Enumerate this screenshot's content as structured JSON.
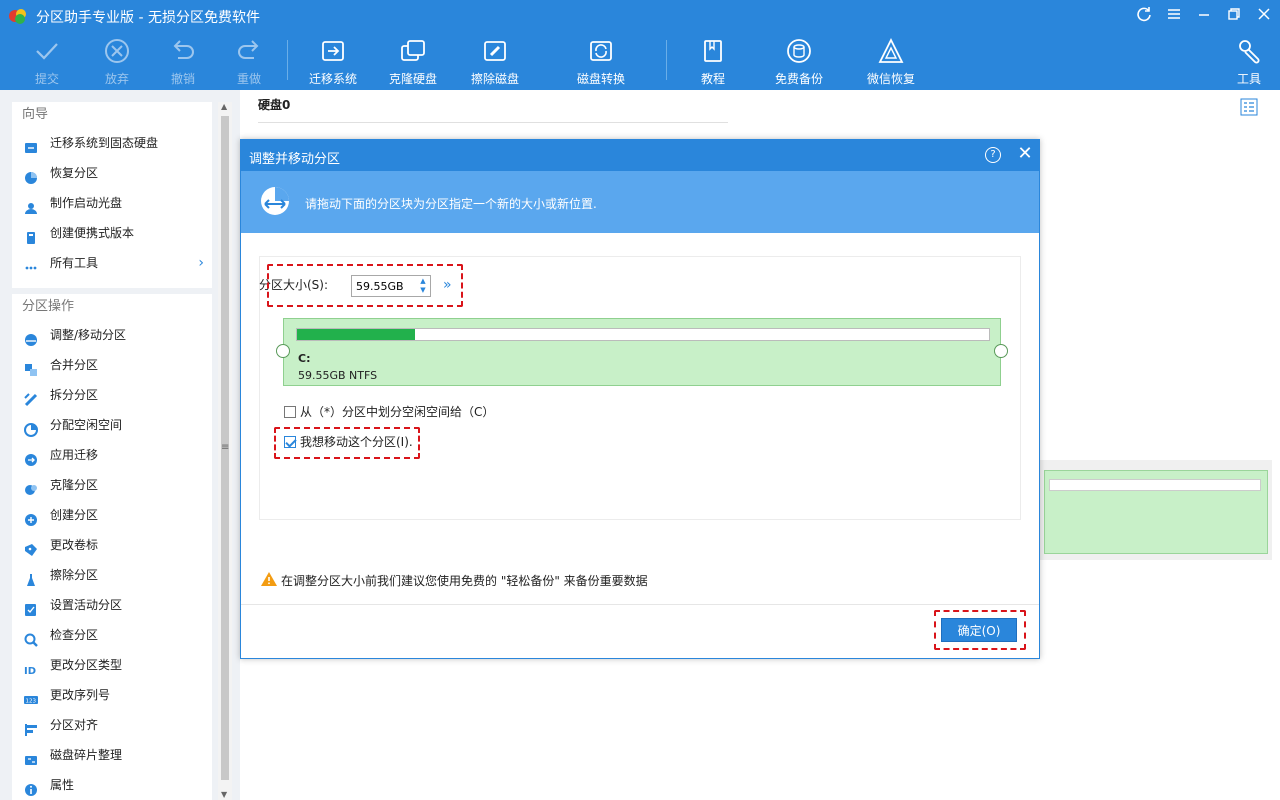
{
  "app": {
    "title": "分区助手专业版 - 无损分区免费软件"
  },
  "toolbar": {
    "commit": "提交",
    "discard": "放弃",
    "undo": "撤销",
    "redo": "重做",
    "migrate_os": "迁移系统",
    "clone_disk": "克隆硬盘",
    "wipe_disk": "擦除磁盘",
    "disk_convert": "磁盘转换",
    "tutorial": "教程",
    "free_backup": "免费备份",
    "wechat_recovery": "微信恢复",
    "tools": "工具"
  },
  "sidebar": {
    "wizard_header": "向导",
    "wizard_items": [
      {
        "label": "迁移系统到固态硬盘",
        "icon": "migrate-icon"
      },
      {
        "label": "恢复分区",
        "icon": "recover-icon"
      },
      {
        "label": "制作启动光盘",
        "icon": "bootable-disc-icon"
      },
      {
        "label": "创建便携式版本",
        "icon": "portable-icon"
      },
      {
        "label": "所有工具",
        "icon": "more-icon"
      }
    ],
    "ops_header": "分区操作",
    "ops_items": [
      {
        "label": "调整/移动分区",
        "icon": "resize-icon"
      },
      {
        "label": "合并分区",
        "icon": "merge-icon"
      },
      {
        "label": "拆分分区",
        "icon": "split-icon"
      },
      {
        "label": "分配空闲空间",
        "icon": "allocate-icon"
      },
      {
        "label": "应用迁移",
        "icon": "app-move-icon"
      },
      {
        "label": "克隆分区",
        "icon": "clone-icon"
      },
      {
        "label": "创建分区",
        "icon": "create-icon"
      },
      {
        "label": "更改卷标",
        "icon": "label-icon"
      },
      {
        "label": "擦除分区",
        "icon": "wipe-icon"
      },
      {
        "label": "设置活动分区",
        "icon": "active-icon"
      },
      {
        "label": "检查分区",
        "icon": "check-icon"
      },
      {
        "label": "更改分区类型",
        "icon": "id-icon"
      },
      {
        "label": "更改序列号",
        "icon": "serial-icon"
      },
      {
        "label": "分区对齐",
        "icon": "align-icon"
      },
      {
        "label": "磁盘碎片整理",
        "icon": "defrag-icon"
      },
      {
        "label": "属性",
        "icon": "info-icon"
      }
    ]
  },
  "main": {
    "disk_label": "硬盘0"
  },
  "dialog": {
    "title": "调整并移动分区",
    "banner_text": "请拖动下面的分区块为分区指定一个新的大小或新位置.",
    "size_label": "分区大小(S):",
    "size_value": "59.55GB",
    "partition_letter": "C:",
    "partition_size": "59.55GB NTFS",
    "partition_used_fraction": 0.17,
    "allocate_option": "从（*）分区中划分空闲空间给（C）",
    "allocate_checked": false,
    "move_option": "我想移动这个分区(I).",
    "move_checked": true,
    "warning_text": "在调整分区大小前我们建议您使用免费的 \"轻松备份\" 来备份重要数据",
    "ok_label": "确定(O)"
  },
  "colors": {
    "accent": "#2a86db",
    "partition_fill": "#c8f0c8",
    "used_bar": "#22b14c",
    "highlight": "#d9141a"
  }
}
